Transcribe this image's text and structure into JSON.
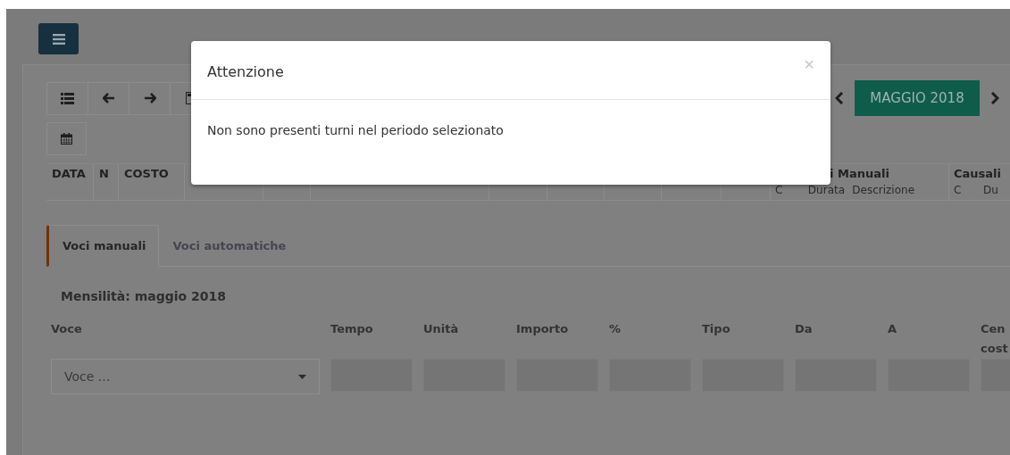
{
  "toolbar": {
    "month_button": "MAGGIO 2018"
  },
  "table_header": {
    "left_columns": [
      "DATA",
      "N",
      "COSTO"
    ],
    "groups": [
      {
        "title": "i Manuali",
        "subcolumns": [
          "C",
          "Durata",
          "Descrizione"
        ]
      },
      {
        "title": "Causali",
        "subcolumns": [
          "C",
          "Du"
        ]
      }
    ]
  },
  "tabs": [
    {
      "label": "Voci manuali",
      "selected": true
    },
    {
      "label": "Voci automatiche",
      "selected": false
    }
  ],
  "period_label": "Mensilità: maggio 2018",
  "form_columns": [
    {
      "label": "Voce",
      "kind": "select",
      "placeholder": "Voce ..."
    },
    {
      "label": "Tempo",
      "kind": "input"
    },
    {
      "label": "Unità",
      "kind": "input"
    },
    {
      "label": "Importo",
      "kind": "input"
    },
    {
      "label": "%",
      "kind": "input"
    },
    {
      "label": "Tipo",
      "kind": "input"
    },
    {
      "label": "Da",
      "kind": "input"
    },
    {
      "label": "A",
      "kind": "input"
    },
    {
      "label": "Cen cost",
      "kind": "input"
    }
  ],
  "modal": {
    "title": "Attenzione",
    "close": "×",
    "message": "Non sono presenti turni nel periodo selezionato"
  }
}
